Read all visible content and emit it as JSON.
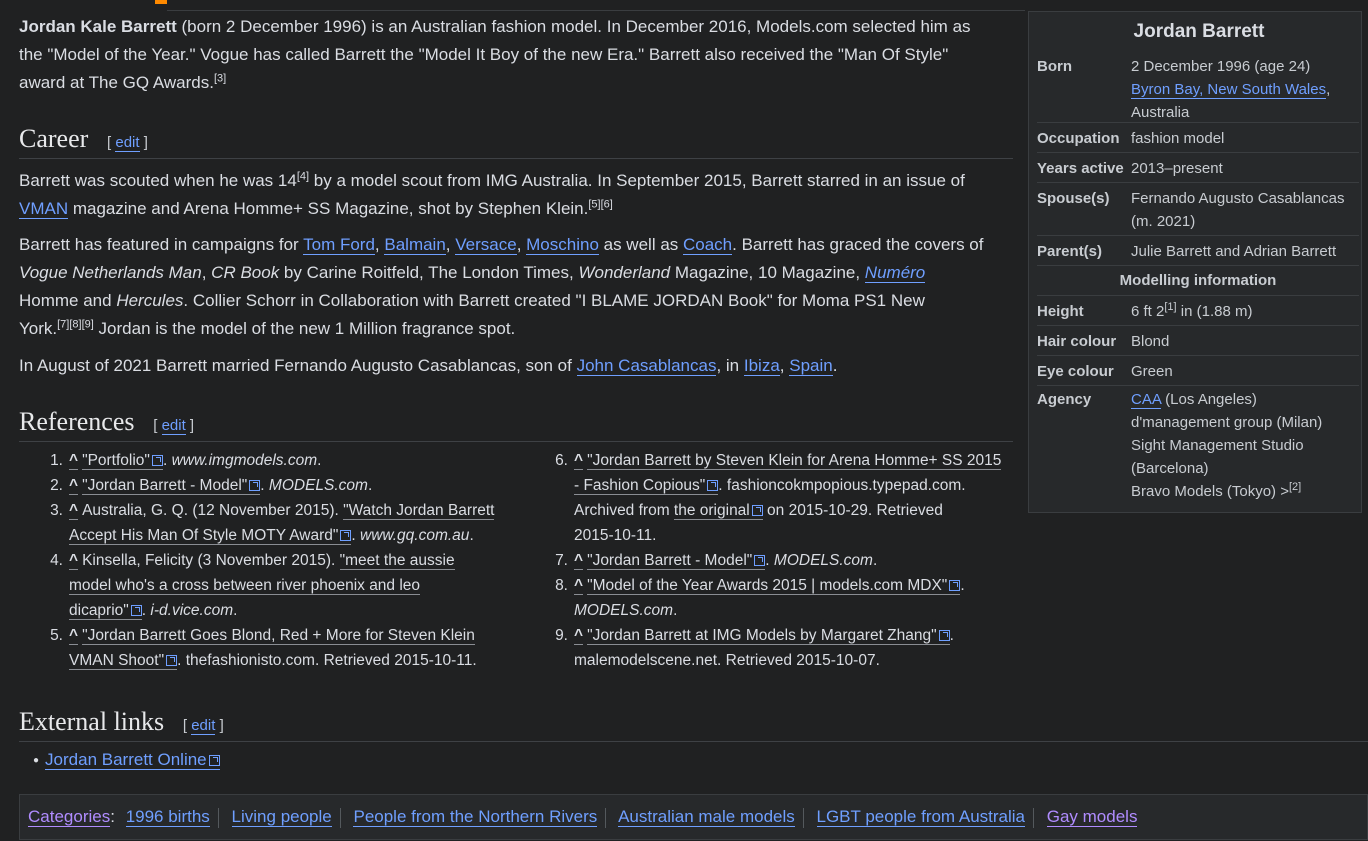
{
  "intro": {
    "name": "Jordan Kale Barrett",
    "text1": " (born 2 December 1996) is an Australian fashion model. In December 2016, Models.com selected him as",
    "text2": "the \"Model of the Year.\" Vogue has called Barrett the \"Model It Boy of the new Era.\" Barrett also received the \"Man Of Style\"",
    "text3": "award at The GQ Awards.",
    "sup": "[3]"
  },
  "edit_label": "edit",
  "career": {
    "heading": "Career",
    "p1_l1": "Barrett was scouted when he was 14",
    "p1_sup1": "[4]",
    "p1_l1b": " by a model scout from IMG Australia. In September 2015, Barrett starred in an issue of",
    "p1_link": "VMAN",
    "p1_l2": " magazine and Arena Homme+ SS Magazine, shot by Stephen Klein.",
    "p1_sup2": "[5][6]",
    "p2_l1a": "Barrett has featured in campaigns for ",
    "links": [
      "Tom Ford",
      "Balmain",
      "Versace",
      "Moschino"
    ],
    "p2_aswell": " as well as ",
    "coach": "Coach",
    "p2_l1b": ". Barrett has graced the covers of",
    "vogue": "Vogue Netherlands Man",
    "crbook": "CR Book",
    "p2_l2a": " by Carine Roitfeld, The London Times, ",
    "wonderland": "Wonderland",
    "p2_l2b": " Magazine, 10 Magazine, ",
    "numero": "Numéro",
    "p2_l3a": "Homme and ",
    "hercules": "Hercules",
    "p2_l3b": ". Collier Schorr in Collaboration with Barrett created \"I BLAME JORDAN Book\" for Moma PS1 New",
    "p2_l4a": "York.",
    "p2_sup": "[7][8][9]",
    "p2_l4b": " Jordan is the model of the new 1 Million fragrance spot.",
    "p3a": "In August of 2021 Barrett married Fernando Augusto Casablancas, son of ",
    "p3_link1": "John Casablancas",
    "p3b": ", in ",
    "p3_link2": "Ibiza",
    "p3c": ", ",
    "p3_link3": "Spain",
    "p3d": "."
  },
  "references": {
    "heading": "References",
    "caret": "^",
    "r1": {
      "num": "1.",
      "title": "\"Portfolio\"",
      "rest": ". ",
      "site": "www.imgmodels.com",
      "end": "."
    },
    "r2": {
      "num": "2.",
      "title": "\"Jordan Barrett - Model\"",
      "rest": ". ",
      "site": "MODELS.com",
      "end": "."
    },
    "r3": {
      "num": "3.",
      "pre": "Australia, G. Q. (12 November 2015). ",
      "title1": "\"Watch Jordan Barrett",
      "title2": "Accept His Man Of Style MOTY Award\"",
      "rest": ". ",
      "site": "www.gq.com.au",
      "end": "."
    },
    "r4": {
      "num": "4.",
      "pre": "Kinsella, Felicity (3 November 2015). ",
      "title1": "\"meet the aussie",
      "title2": "model who's a cross between river phoenix and leo",
      "title3": "dicaprio\"",
      "rest": ". ",
      "site": "i-d.vice.com",
      "end": "."
    },
    "r5": {
      "num": "5.",
      "title1": "\"Jordan Barrett Goes Blond, Red + More for Steven Klein",
      "title2": "VMAN Shoot\"",
      "rest": ". thefashionisto.com. Retrieved 2015-10-11."
    },
    "r6": {
      "num": "6.",
      "title1": "\"Jordan Barrett by Steven Klein for Arena Homme+ SS 2015",
      "title2": "- Fashion Copious\"",
      "rest": ". fashioncokmpopious.typepad.com.",
      "l3a": "Archived from ",
      "orig": "the original",
      "l3b": " on 2015-10-29. Retrieved",
      "l4": "2015-10-11."
    },
    "r7": {
      "num": "7.",
      "title": "\"Jordan Barrett - Model\"",
      "rest": ". ",
      "site": "MODELS.com",
      "end": "."
    },
    "r8": {
      "num": "8.",
      "title": "\"Model of the Year Awards 2015 | models.com MDX\"",
      "rest": ".",
      "site": "MODELS.com",
      "end": "."
    },
    "r9": {
      "num": "9.",
      "title": "\"Jordan Barrett at IMG Models by Margaret Zhang\"",
      "rest": ".",
      "l2": "malemodelscene.net. Retrieved 2015-10-07."
    }
  },
  "external": {
    "heading": "External links",
    "link": "Jordan Barrett Online"
  },
  "infobox": {
    "title": "Jordan Barrett",
    "born_label": "Born",
    "born_l1": "2 December 1996 (age 24)",
    "born_link": "Byron Bay, New South Wales",
    "born_comma": ",",
    "born_l3": "Australia",
    "occ_label": "Occupation",
    "occ": "fashion model",
    "years_label": "Years active",
    "years": "2013–present",
    "spouse_label": "Spouse(s)",
    "spouse_l1": "Fernando Augusto Casablancas",
    "spouse_l2": "(m. 2021)",
    "parents_label": "Parent(s)",
    "parents": "Julie Barrett and Adrian Barrett",
    "modelling_head": "Modelling information",
    "height_label": "Height",
    "height_a": "6 ft 2",
    "height_sup": "[1]",
    "height_b": " in (1.88 m)",
    "hair_label": "Hair colour",
    "hair": "Blond",
    "eye_label": "Eye colour",
    "eye": "Green",
    "agency_label": "Agency",
    "agency_link": "CAA",
    "agency_l1": " (Los Angeles)",
    "agency_l2": "d'management group (Milan)",
    "agency_l3": "Sight Management Studio",
    "agency_l4": "(Barcelona)",
    "agency_l5": "Bravo Models (Tokyo) >",
    "agency_sup": "[2]"
  },
  "categories": {
    "label": "Categories",
    "colon": ":",
    "items": [
      "1996 births",
      "Living people",
      "People from the Northern Rivers",
      "Australian male models",
      "LGBT people from Australia",
      "Gay models"
    ]
  }
}
